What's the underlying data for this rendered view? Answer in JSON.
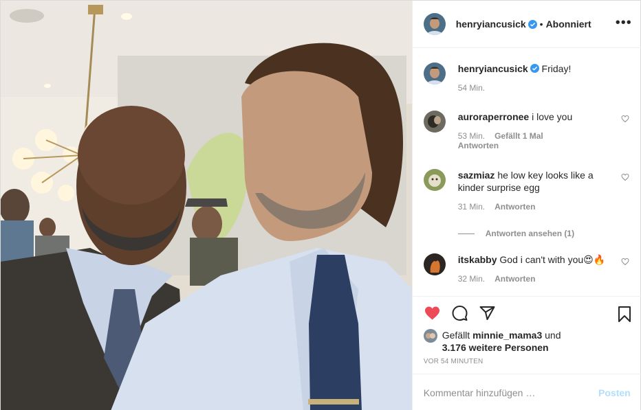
{
  "colors": {
    "like_red": "#ed4956",
    "text": "#262626",
    "muted": "#8e8e8e",
    "verified_blue": "#3897f0",
    "post_button_disabled": "#b2dffc"
  },
  "photo": {
    "alt_subject": "selfie of two men"
  },
  "header": {
    "username": "henryiancusick",
    "separator": "•",
    "follow_state": "Abonniert",
    "more_icon": "more-horizontal-icon"
  },
  "caption": {
    "username": "henryiancusick",
    "text": "Friday!",
    "time": "54 Min."
  },
  "comments": [
    {
      "username": "auroraperronee",
      "text": "i love you",
      "time": "53 Min.",
      "likes": "Gefällt 1 Mal",
      "reply": "Antworten"
    },
    {
      "username": "sazmiaz",
      "text": "he low key looks like a kinder surprise egg",
      "time": "31 Min.",
      "reply": "Antworten"
    },
    {
      "username": "itskabby",
      "text": "God i can't with you😍🔥",
      "time": "32 Min.",
      "reply": "Antworten"
    }
  ],
  "view_replies": "Antworten ansehen (1)",
  "actions": {
    "like_icon": "heart-filled-icon",
    "comment_icon": "comment-icon",
    "share_icon": "paper-plane-icon",
    "save_icon": "bookmark-icon"
  },
  "likes_line": {
    "prefix": "Gefällt",
    "user": "minnie_mama3",
    "conj": "und",
    "others": "3.176 weitere Personen"
  },
  "timestamp": "VOR 54 MINUTEN",
  "comment_input": {
    "placeholder": "Kommentar hinzufügen …",
    "post_label": "Posten"
  }
}
